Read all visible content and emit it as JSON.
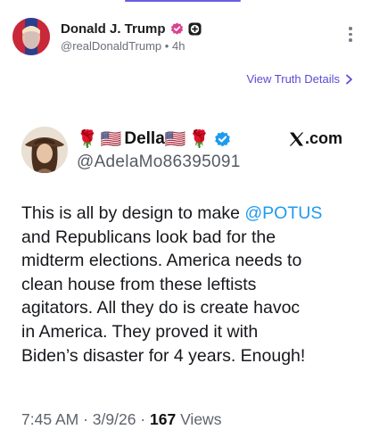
{
  "post": {
    "author_name": "Donald J. Trump",
    "handle": "@realDonaldTrump",
    "separator": "•",
    "time": "4h",
    "verified_icon": "verified-check-icon",
    "plus_icon": "plus-badge-icon",
    "menu_icon": "kebab-menu-icon",
    "view_details_label": "View Truth Details",
    "accent_color": "#5a4bd6"
  },
  "quote": {
    "flag_emoji": "🇺🇸",
    "rose_emoji": "🌹",
    "display_name": "Della",
    "handle": "@AdelaMo86395091",
    "verified_icon": "blue-verified-icon",
    "platform_label": ".com",
    "platform_icon": "x-logo-icon",
    "body_lines": [
      "This is all by design to make ",
      "and Republicans look bad for the",
      "midterm elections.  America needs to",
      "clean house from these leftists",
      "agitators.  All they do is create havoc",
      "in America.  They proved it with",
      "Biden’s disaster for 4 years.  Enough!"
    ],
    "mention": "@POTUS",
    "mention_color": "#1d9bf0",
    "time": "7:45 AM",
    "date": "3/9/26",
    "views_count": "167",
    "views_label": "Views"
  }
}
